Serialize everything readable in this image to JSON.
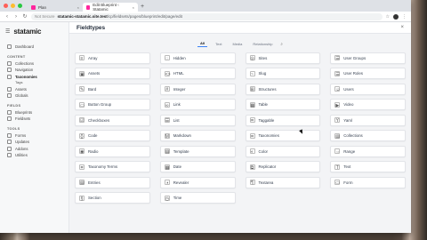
{
  "browser": {
    "tabs": [
      {
        "label": "Plan",
        "active": false
      },
      {
        "label": "Edit Blueprint ‹ Statamic",
        "active": true
      }
    ],
    "nav": {
      "back": "‹",
      "forward": "›",
      "reload": "↻"
    },
    "address": {
      "security": "Not Secure",
      "host": "statamic-statamic.site.test",
      "path": "/cp/fieldsets/pages/blueprint/edit/page/edit"
    }
  },
  "sidebar": {
    "brand": "statamic",
    "top": [
      {
        "label": "Dashboard"
      }
    ],
    "sections": [
      {
        "title": "CONTENT",
        "items": [
          {
            "label": "Collections",
            "current": false
          },
          {
            "label": "Navigation",
            "current": false
          },
          {
            "label": "Taxonomies",
            "current": true
          }
        ],
        "subs": [
          "Tags"
        ]
      },
      {
        "title": "",
        "items": [
          {
            "label": "Assets",
            "current": false
          },
          {
            "label": "Globals",
            "current": false
          }
        ]
      },
      {
        "title": "FIELDS",
        "items": [
          {
            "label": "Blueprints",
            "current": false
          },
          {
            "label": "Fieldsets",
            "current": false
          }
        ]
      },
      {
        "title": "TOOLS",
        "items": [
          {
            "label": "Forms",
            "current": false
          },
          {
            "label": "Updates",
            "current": false
          },
          {
            "label": "Addons",
            "current": false
          },
          {
            "label": "Utilities",
            "current": false
          }
        ]
      }
    ]
  },
  "main": {
    "title": "Fieldtypes",
    "close": "×",
    "filters": [
      "All",
      "Text",
      "Media",
      "Relationship"
    ],
    "active_filter": "All",
    "search_icon": "search-icon",
    "fieldtypes": [
      {
        "label": "Array",
        "icon": "array-icon",
        "glyph": "≡"
      },
      {
        "label": "Hidden",
        "icon": "hidden-icon",
        "glyph": "◌"
      },
      {
        "label": "Sites",
        "icon": "sites-icon",
        "glyph": "◎"
      },
      {
        "label": "User Groups",
        "icon": "user-groups-icon",
        "glyph": "☰"
      },
      {
        "label": "Assets",
        "icon": "assets-icon",
        "glyph": "▣"
      },
      {
        "label": "HTML",
        "icon": "html-icon",
        "glyph": "<>"
      },
      {
        "label": "Slug",
        "icon": "slug-icon",
        "glyph": "~"
      },
      {
        "label": "User Roles",
        "icon": "user-roles-icon",
        "glyph": "☰"
      },
      {
        "label": "Bard",
        "icon": "bard-icon",
        "glyph": "✎"
      },
      {
        "label": "Integer",
        "icon": "integer-icon",
        "glyph": "#"
      },
      {
        "label": "Structures",
        "icon": "structures-icon",
        "glyph": "⊞"
      },
      {
        "label": "Users",
        "icon": "users-icon",
        "glyph": "☺"
      },
      {
        "label": "Button Group",
        "icon": "button-group-icon",
        "glyph": "▭"
      },
      {
        "label": "Link",
        "icon": "link-icon",
        "glyph": "∞"
      },
      {
        "label": "Table",
        "icon": "table-icon",
        "glyph": "▦"
      },
      {
        "label": "Video",
        "icon": "video-icon",
        "glyph": "▶"
      },
      {
        "label": "Checkboxes",
        "icon": "checkboxes-icon",
        "glyph": "☑"
      },
      {
        "label": "List",
        "icon": "list-icon",
        "glyph": "☰"
      },
      {
        "label": "Taggable",
        "icon": "taggable-icon",
        "glyph": "⌗"
      },
      {
        "label": "Yaml",
        "icon": "yaml-icon",
        "glyph": "Y"
      },
      {
        "label": "Code",
        "icon": "code-icon",
        "glyph": "{}"
      },
      {
        "label": "Markdown",
        "icon": "markdown-icon",
        "glyph": "M"
      },
      {
        "label": "Taxonomies",
        "icon": "taxonomies-icon",
        "glyph": "⌗"
      },
      {
        "label": "Collections",
        "icon": "collections-icon",
        "glyph": "▤"
      },
      {
        "label": "Radio",
        "icon": "radio-icon",
        "glyph": "◉"
      },
      {
        "label": "Template",
        "icon": "template-icon",
        "glyph": "▤"
      },
      {
        "label": "Color",
        "icon": "color-icon",
        "glyph": "◐"
      },
      {
        "label": "Range",
        "icon": "range-icon",
        "glyph": "⇔"
      },
      {
        "label": "Taxonomy Terms",
        "icon": "taxonomy-terms-icon",
        "glyph": "⌗"
      },
      {
        "label": "Date",
        "icon": "date-icon",
        "glyph": "▦"
      },
      {
        "label": "Replicator",
        "icon": "replicator-icon",
        "glyph": "⧉"
      },
      {
        "label": "Text",
        "icon": "text-icon",
        "glyph": "T"
      },
      {
        "label": "Entries",
        "icon": "entries-icon",
        "glyph": "▤"
      },
      {
        "label": "Revealer",
        "icon": "revealer-icon",
        "glyph": "◑"
      },
      {
        "label": "Textarea",
        "icon": "textarea-icon",
        "glyph": "¶"
      },
      {
        "label": "Form",
        "icon": "form-icon",
        "glyph": "▭"
      },
      {
        "label": "Section",
        "icon": "section-icon",
        "glyph": "§"
      },
      {
        "label": "Time",
        "icon": "time-icon",
        "glyph": "◷"
      }
    ]
  },
  "colors": {
    "accent": "#3b82f6",
    "brand_fav": "#ff269e"
  }
}
